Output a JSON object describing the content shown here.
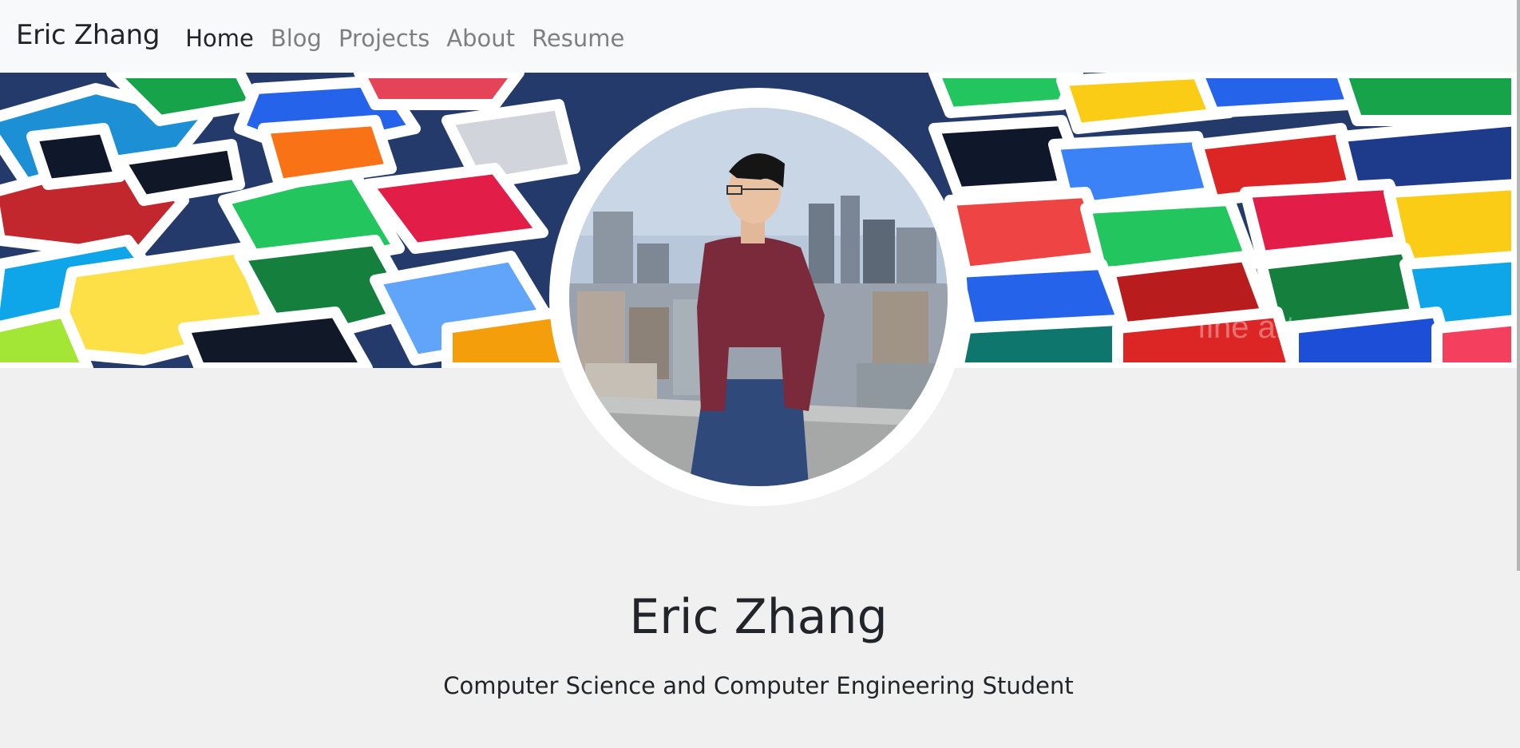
{
  "navbar": {
    "brand": "Eric Zhang",
    "links": [
      {
        "label": "Home",
        "active": true
      },
      {
        "label": "Blog",
        "active": false
      },
      {
        "label": "Projects",
        "active": false
      },
      {
        "label": "About",
        "active": false
      },
      {
        "label": "Resume",
        "active": false
      }
    ]
  },
  "banner": {
    "watermark": "fine art"
  },
  "hero": {
    "name": "Eric Zhang",
    "subtitle": "Computer Science and Computer Engineering Student"
  },
  "colors": {
    "navbar_bg": "#f8f9fa",
    "page_bg": "#f0f0f0",
    "text": "#212529",
    "nav_muted": "#7f7f7f"
  }
}
